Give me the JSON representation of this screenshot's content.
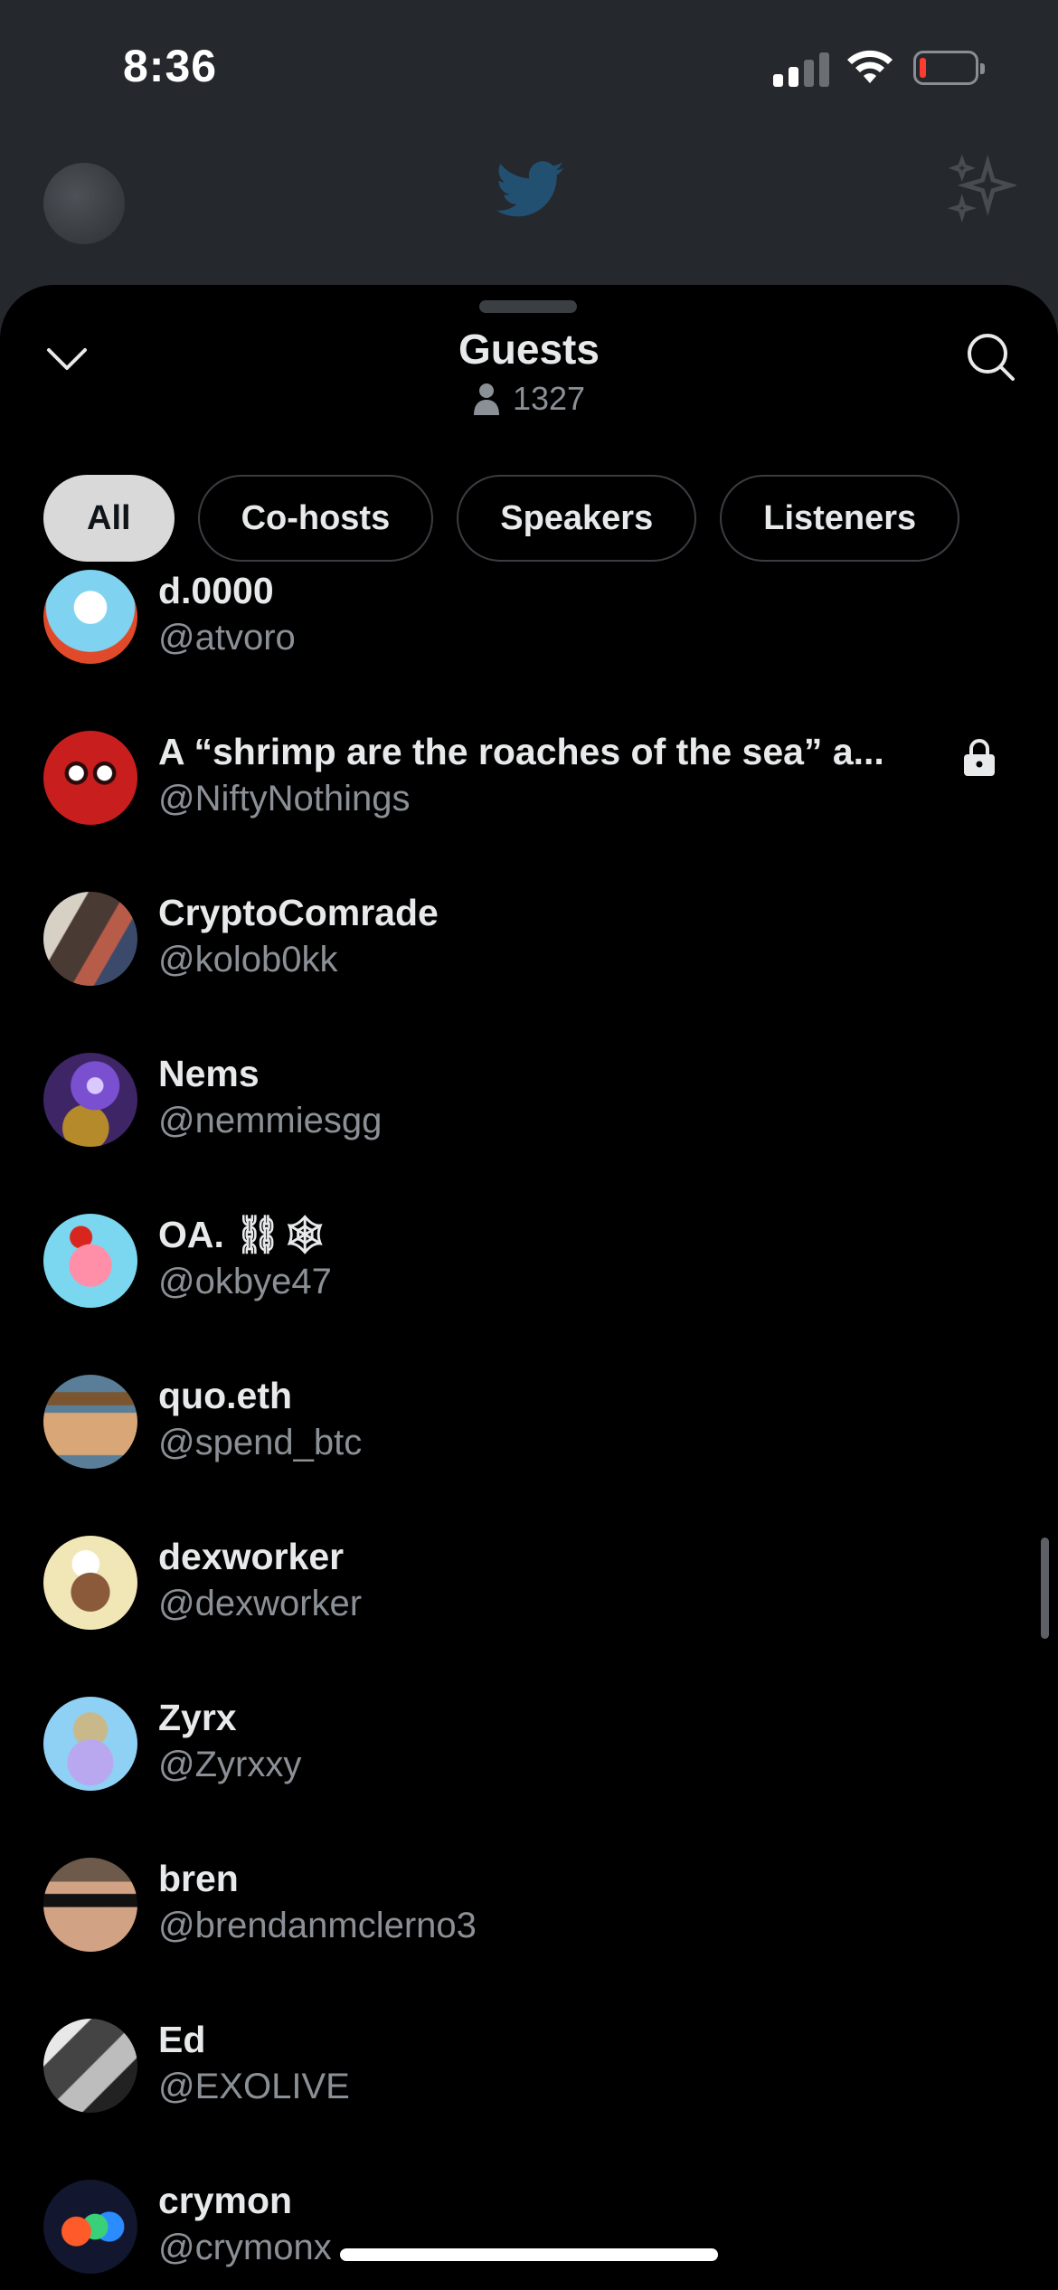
{
  "status_bar": {
    "time": "8:36",
    "battery_color": "#ff3b30"
  },
  "sheet": {
    "title": "Guests",
    "listener_count": "1327",
    "icons": {
      "collapse": "chevron-down-icon",
      "search": "search-icon",
      "count": "person-icon"
    }
  },
  "tabs": [
    {
      "label": "All",
      "active": true
    },
    {
      "label": "Co-hosts",
      "active": false
    },
    {
      "label": "Speakers",
      "active": false
    },
    {
      "label": "Listeners",
      "active": false
    }
  ],
  "guests": [
    {
      "name": "d.0000",
      "handle": "@atvoro",
      "avatar_color": "#7fd3f0"
    },
    {
      "name": "A “shrimp are the roaches of the sea” a...",
      "handle": "@NiftyNothings",
      "avatar_color": "#c81e1e",
      "protected": true
    },
    {
      "name": "CryptoComrade",
      "handle": "@kolob0kk",
      "avatar_color": "#6b5a50"
    },
    {
      "name": "Nems",
      "handle": "@nemmiesgg",
      "avatar_color": "#6b3fa3"
    },
    {
      "name": "OA. ⛓🕸",
      "handle": "@okbye47",
      "avatar_color": "#7ad7ef"
    },
    {
      "name": "quo.eth",
      "handle": "@spend_btc",
      "avatar_color": "#5a7e98"
    },
    {
      "name": "dexworker",
      "handle": "@dexworker",
      "avatar_color": "#f1e6b5"
    },
    {
      "name": "Zyrx",
      "handle": "@Zyrxxy",
      "avatar_color": "#8fd0f5"
    },
    {
      "name": "bren",
      "handle": "@brendanmclerno3",
      "avatar_color": "#b07a5c"
    },
    {
      "name": "Ed",
      "handle": "@EXOLIVE",
      "avatar_color": "#6d6d6d"
    },
    {
      "name": "crymon",
      "handle": "@crymonx",
      "avatar_color": "#1a1f3a"
    }
  ]
}
